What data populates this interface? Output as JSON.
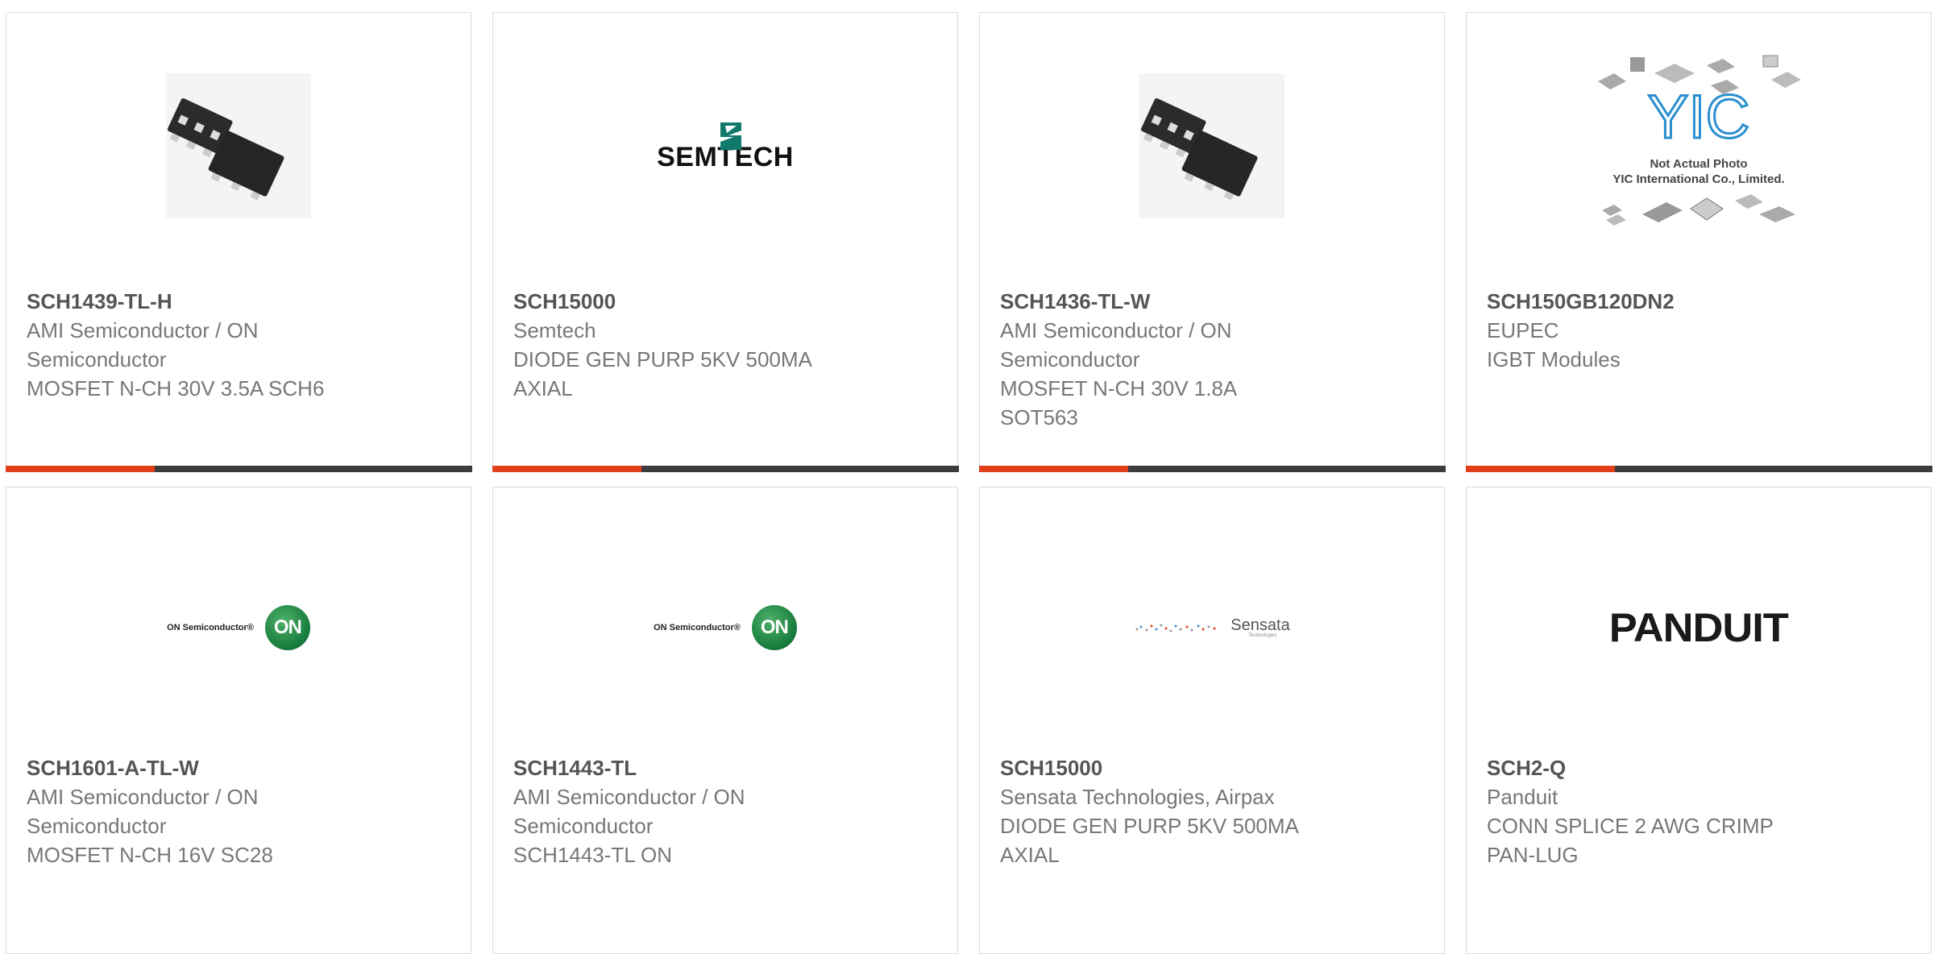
{
  "cards": [
    {
      "part_number": "SCH1439-TL-H",
      "manufacturer_lines": [
        "AMI Semiconductor / ON",
        "Semiconductor"
      ],
      "description_lines": [
        "MOSFET N-CH 30V 3.5A SCH6"
      ],
      "image": "sot-chip-package-icon"
    },
    {
      "part_number": "SCH15000",
      "manufacturer_lines": [
        "Semtech"
      ],
      "description_lines": [
        "DIODE GEN PURP 5KV 500MA",
        "AXIAL"
      ],
      "image": "semtech-logo",
      "logo_text": "SEMTECH"
    },
    {
      "part_number": "SCH1436-TL-W",
      "manufacturer_lines": [
        "AMI Semiconductor / ON",
        "Semiconductor"
      ],
      "description_lines": [
        "MOSFET N-CH 30V 1.8A",
        "SOT563"
      ],
      "image": "sot-chip-package-icon"
    },
    {
      "part_number": "SCH150GB120DN2",
      "manufacturer_lines": [
        "EUPEC"
      ],
      "description_lines": [
        "IGBT Modules"
      ],
      "image": "yic-placeholder-image",
      "logo_text": "YIC",
      "placeholder_line1": "Not Actual Photo",
      "placeholder_line2": "YIC International Co., Limited."
    },
    {
      "part_number": "SCH1601-A-TL-W",
      "manufacturer_lines": [
        "AMI Semiconductor / ON",
        "Semiconductor"
      ],
      "description_lines": [
        "MOSFET N-CH 16V SC28"
      ],
      "image": "on-semiconductor-logo",
      "logo_text": "ON Semiconductor®",
      "logo_badge": "ON"
    },
    {
      "part_number": "SCH1443-TL",
      "manufacturer_lines": [
        "AMI Semiconductor / ON",
        "Semiconductor"
      ],
      "description_lines": [
        "SCH1443-TL ON"
      ],
      "image": "on-semiconductor-logo",
      "logo_text": "ON Semiconductor®",
      "logo_badge": "ON"
    },
    {
      "part_number": "SCH15000",
      "manufacturer_lines": [
        "Sensata Technologies, Airpax"
      ],
      "description_lines": [
        "DIODE GEN PURP 5KV 500MA",
        "AXIAL"
      ],
      "image": "sensata-logo",
      "logo_text": "Sensata",
      "logo_sub": "Technologies"
    },
    {
      "part_number": "SCH2-Q",
      "manufacturer_lines": [
        "Panduit"
      ],
      "description_lines": [
        "CONN SPLICE 2 AWG CRIMP",
        "PAN-LUG"
      ],
      "image": "panduit-logo",
      "logo_text": "PANDUIT"
    }
  ],
  "colors": {
    "accent": "#e2401c",
    "bar": "#3c3c3c",
    "border": "#dcdcdc",
    "text": "#777777",
    "title": "#555555"
  }
}
